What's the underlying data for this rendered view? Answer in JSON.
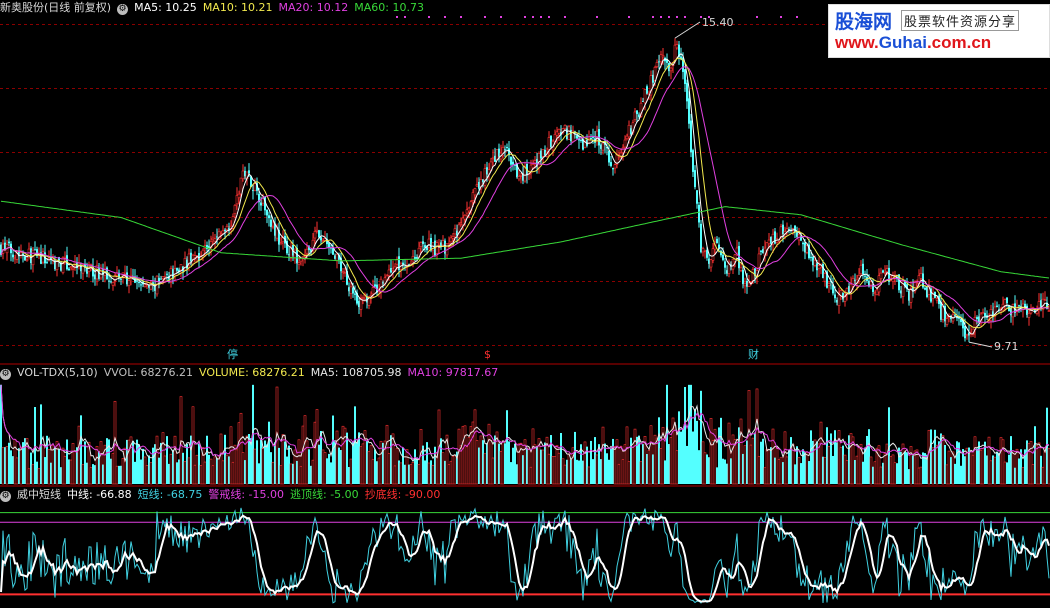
{
  "legend_main": {
    "title": "新奥股份(日线 前复权)",
    "items": [
      {
        "label": "MA5: 10.25",
        "color": "#ffffff"
      },
      {
        "label": "MA10: 10.21",
        "color": "#f2e94e"
      },
      {
        "label": "MA20: 10.12",
        "color": "#e040e0"
      },
      {
        "label": "MA60: 10.73",
        "color": "#38d838"
      }
    ]
  },
  "legend_vol": {
    "title": "VOL-TDX(5,10)",
    "items": [
      {
        "label": "VVOL: 68276.21",
        "color": "#c0c0c0"
      },
      {
        "label": "VOLUME: 68276.21",
        "color": "#f2e94e"
      },
      {
        "label": "MA5: 108705.98",
        "color": "#e8e8e8"
      },
      {
        "label": "MA10: 97817.67",
        "color": "#e040e0"
      }
    ]
  },
  "legend_ind": {
    "title": "威中短线",
    "items": [
      {
        "label": "中线: -66.88",
        "color": "#ffffff"
      },
      {
        "label": "短线: -68.75",
        "color": "#40d0e0"
      },
      {
        "label": "警戒线: -15.00",
        "color": "#e040e0"
      },
      {
        "label": "逃顶线: -5.00",
        "color": "#38d838"
      },
      {
        "label": "抄底线: -90.00",
        "color": "#ff3030"
      }
    ]
  },
  "watermark": {
    "logo": "股海网",
    "slogan": "股票软件资源分享",
    "url_prefix": "www.",
    "url_brand": "Guhai",
    "url_suffix": ".com.cn"
  },
  "markers": [
    {
      "text": "停",
      "color": "#40d0e0"
    },
    {
      "text": "$",
      "color": "#ff3030"
    },
    {
      "text": "财",
      "color": "#40d0e0"
    }
  ],
  "annotations": {
    "high": "15.40",
    "low": "9.71"
  },
  "colors": {
    "up": "#ff3232",
    "down": "#54ffff",
    "ma5": "#ffffff",
    "ma10": "#f2e94e",
    "ma20": "#e040e0",
    "ma60": "#38d838",
    "grid": "#8b0000",
    "mid": "#ffffff",
    "short": "#40d0e0",
    "warn": "#e040e0",
    "top": "#38d838",
    "bottom": "#ff3030"
  },
  "chart_data": {
    "type": "candlestick",
    "panels": [
      {
        "name": "price",
        "yrange": [
          9.5,
          15.6
        ]
      },
      {
        "name": "volume",
        "yrange": [
          0,
          180000
        ]
      },
      {
        "name": "indicator",
        "yrange": [
          -100,
          5
        ],
        "levels": {
          "警戒线": -15,
          "逃顶线": -5,
          "抄底线": -90
        }
      }
    ],
    "price_path": [
      [
        0,
        11.3
      ],
      [
        20,
        11.1
      ],
      [
        40,
        10.9
      ],
      [
        60,
        10.75
      ],
      [
        75,
        10.55
      ],
      [
        90,
        10.95
      ],
      [
        105,
        11.35
      ],
      [
        115,
        11.8
      ],
      [
        122,
        12.75
      ],
      [
        130,
        12.2
      ],
      [
        140,
        11.4
      ],
      [
        150,
        11.0
      ],
      [
        158,
        11.55
      ],
      [
        165,
        11.25
      ],
      [
        172,
        10.75
      ],
      [
        180,
        10.25
      ],
      [
        188,
        10.55
      ],
      [
        196,
        10.95
      ],
      [
        204,
        11.05
      ],
      [
        212,
        11.35
      ],
      [
        220,
        11.25
      ],
      [
        228,
        11.55
      ],
      [
        236,
        12.2
      ],
      [
        244,
        12.8
      ],
      [
        252,
        13.15
      ],
      [
        258,
        12.6
      ],
      [
        266,
        12.75
      ],
      [
        274,
        13.2
      ],
      [
        282,
        13.45
      ],
      [
        290,
        13.2
      ],
      [
        298,
        13.35
      ],
      [
        306,
        12.8
      ],
      [
        312,
        13.25
      ],
      [
        318,
        13.75
      ],
      [
        322,
        14.1
      ],
      [
        326,
        14.4
      ],
      [
        330,
        14.85
      ],
      [
        334,
        14.6
      ],
      [
        338,
        15.0
      ],
      [
        341,
        14.5
      ],
      [
        344,
        13.6
      ],
      [
        347,
        12.3
      ],
      [
        350,
        11.35
      ],
      [
        354,
        11.0
      ],
      [
        358,
        11.4
      ],
      [
        363,
        10.85
      ],
      [
        368,
        11.2
      ],
      [
        372,
        10.55
      ],
      [
        376,
        10.8
      ],
      [
        382,
        11.3
      ],
      [
        388,
        11.55
      ],
      [
        394,
        11.6
      ],
      [
        400,
        11.35
      ],
      [
        406,
        11.1
      ],
      [
        412,
        10.75
      ],
      [
        418,
        10.35
      ],
      [
        424,
        10.6
      ],
      [
        430,
        10.85
      ],
      [
        436,
        10.55
      ],
      [
        442,
        10.8
      ],
      [
        448,
        10.65
      ],
      [
        454,
        10.45
      ],
      [
        460,
        10.7
      ],
      [
        466,
        10.35
      ],
      [
        470,
        10.1
      ],
      [
        474,
        10.0
      ],
      [
        478,
        9.9
      ],
      [
        482,
        9.75
      ],
      [
        486,
        9.85
      ],
      [
        490,
        9.95
      ],
      [
        496,
        10.05
      ],
      [
        502,
        10.2
      ],
      [
        508,
        10.1
      ],
      [
        514,
        10.15
      ],
      [
        520,
        10.2
      ],
      [
        525,
        10.25
      ]
    ],
    "ma60_path": [
      [
        0,
        12.15
      ],
      [
        60,
        11.85
      ],
      [
        110,
        11.2
      ],
      [
        170,
        11.05
      ],
      [
        230,
        11.1
      ],
      [
        280,
        11.4
      ],
      [
        330,
        11.8
      ],
      [
        362,
        12.05
      ],
      [
        400,
        11.9
      ],
      [
        450,
        11.35
      ],
      [
        500,
        10.85
      ],
      [
        525,
        10.73
      ]
    ],
    "highlights": {
      "high": 15.4,
      "low": 9.71
    }
  }
}
